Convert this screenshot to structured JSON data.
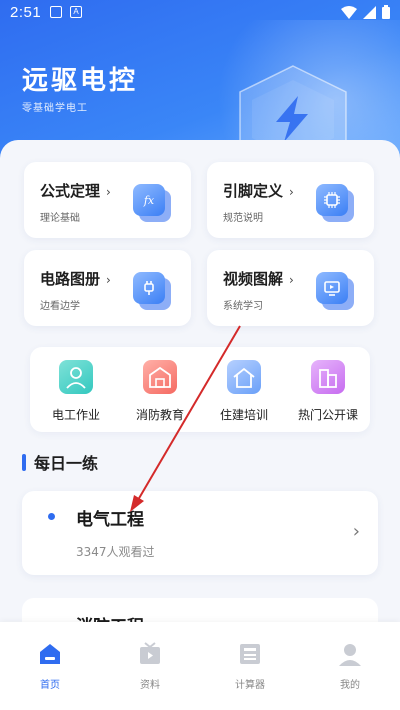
{
  "status_bar": {
    "time": "2:51"
  },
  "header": {
    "title": "远驱电控",
    "subtitle": "零基础学电工"
  },
  "cards": [
    {
      "title": "公式定理",
      "arrow": "›",
      "subtitle": "理论基础",
      "icon": "fx-icon",
      "icon_text": "fx"
    },
    {
      "title": "引脚定义",
      "arrow": "›",
      "subtitle": "规范说明",
      "icon": "chip-icon",
      "icon_text": ""
    },
    {
      "title": "电路图册",
      "arrow": "›",
      "subtitle": "边看边学",
      "icon": "plug-icon",
      "icon_text": ""
    },
    {
      "title": "视频图解",
      "arrow": "›",
      "subtitle": "系统学习",
      "icon": "monitor-icon",
      "icon_text": ""
    }
  ],
  "quick_links": [
    {
      "label": "电工作业",
      "icon": "worker-icon",
      "color": "#33c8bf"
    },
    {
      "label": "消防教育",
      "icon": "fire-station-icon",
      "color": "#f56a62"
    },
    {
      "label": "住建培训",
      "icon": "house-icon",
      "color": "#6aa0f8"
    },
    {
      "label": "热门公开课",
      "icon": "building-icon",
      "color": "#c76cf0"
    }
  ],
  "section": {
    "title": "每日一练"
  },
  "practice": [
    {
      "title": "电气工程",
      "views": "3347人观看过"
    },
    {
      "title": "消防工程"
    }
  ],
  "bottom_nav": [
    {
      "label": "首页",
      "icon": "home-icon",
      "active": true
    },
    {
      "label": "资料",
      "icon": "video-folder-icon",
      "active": false
    },
    {
      "label": "计算器",
      "icon": "calculator-icon",
      "active": false
    },
    {
      "label": "我的",
      "icon": "profile-icon",
      "active": false
    }
  ],
  "colors": {
    "primary": "#2f6cf0",
    "annotation_arrow": "#d42a2a"
  }
}
